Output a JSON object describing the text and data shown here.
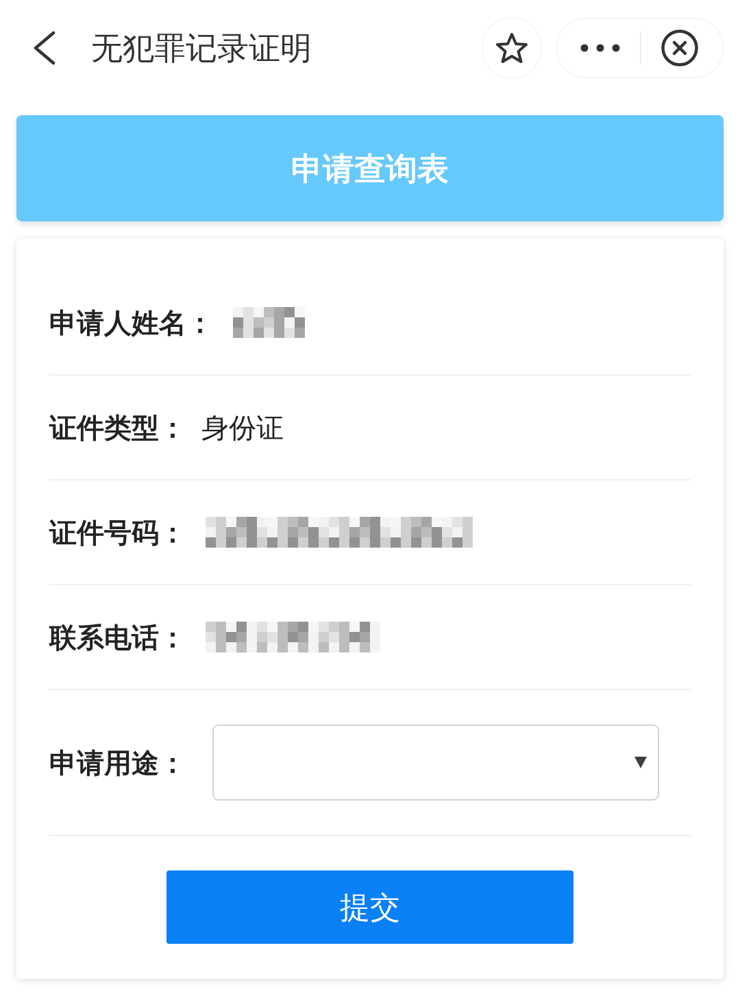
{
  "header": {
    "title": "无犯罪记录证明"
  },
  "banner": {
    "title": "申请查询表"
  },
  "form": {
    "rows": [
      {
        "kind": "redacted",
        "label": "申请人姓名："
      },
      {
        "kind": "text",
        "label": "证件类型：",
        "value": "身份证"
      },
      {
        "kind": "redacted",
        "label": "证件号码："
      },
      {
        "kind": "redacted",
        "label": "联系电话："
      },
      {
        "kind": "select",
        "label": "申请用途："
      }
    ]
  },
  "submit": {
    "label": "提交"
  }
}
